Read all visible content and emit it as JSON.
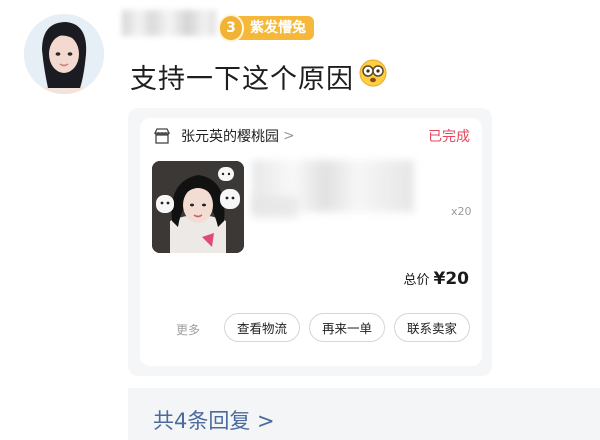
{
  "comment": {
    "badge_level": "3",
    "badge_label": "紫发懵兔",
    "text": "支持一下这个原因",
    "emoji": "flushed-face-with-glasses"
  },
  "order_card": {
    "shop_name": "张元英的樱桃园",
    "shop_chevron": ">",
    "status": "已完成",
    "status_color": "#e8465d",
    "quantity": "x20",
    "total_label": "总价",
    "total_price": "¥20",
    "more_label": "更多",
    "buttons": [
      "查看物流",
      "再来一单",
      "联系卖家"
    ]
  },
  "replies": {
    "label": "共4条回复 >"
  },
  "colors": {
    "badge": "#f6b83a",
    "link": "#4b6a9d"
  }
}
